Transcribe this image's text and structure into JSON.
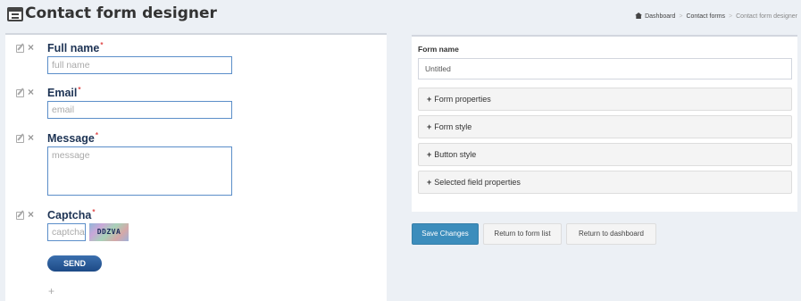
{
  "header": {
    "title": "Contact form designer",
    "breadcrumb": [
      "Dashboard",
      "Contact forms",
      "Contact form designer"
    ]
  },
  "form_preview": {
    "fields": [
      {
        "label": "Full name",
        "required_mark": "*",
        "placeholder": "full name"
      },
      {
        "label": "Email",
        "required_mark": "*",
        "placeholder": "email"
      },
      {
        "label": "Message",
        "required_mark": "*",
        "placeholder": "message"
      },
      {
        "label": "Captcha",
        "required_mark": "*",
        "placeholder": "captcha",
        "captcha_text": "DDZVA"
      }
    ],
    "send_label": "SEND",
    "add_symbol": "+"
  },
  "settings": {
    "form_name_label": "Form name",
    "form_name_value": "Untitled",
    "sections": [
      "Form properties",
      "Form style",
      "Button style",
      "Selected field properties"
    ],
    "plus_symbol": "+"
  },
  "actions": {
    "save": "Save Changes",
    "return_list": "Return to form list",
    "return_dashboard": "Return to dashboard"
  },
  "colors": {
    "primary": "#3c8dbc",
    "label": "#1d3354",
    "required": "#e04b4b",
    "input_border": "#5b8ec9"
  }
}
